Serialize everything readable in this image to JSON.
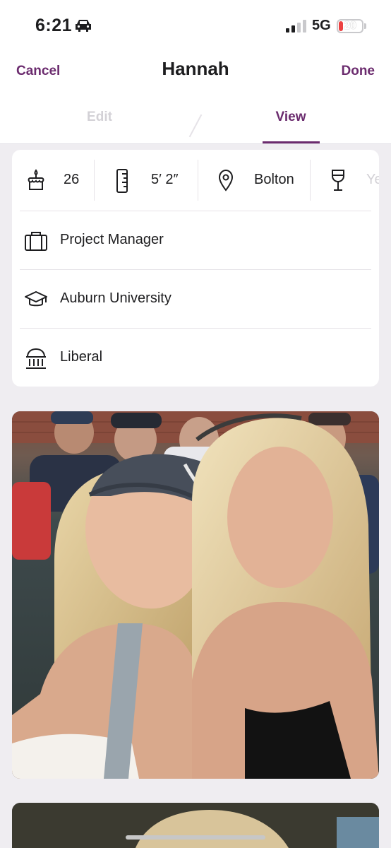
{
  "status_bar": {
    "time": "6:21",
    "network": "5G",
    "battery": "20",
    "battery_level_percent": 20
  },
  "header": {
    "cancel_label": "Cancel",
    "title": "Hannah",
    "done_label": "Done"
  },
  "tabs": [
    {
      "label": "Edit",
      "active": false
    },
    {
      "label": "View",
      "active": true
    }
  ],
  "vitals": [
    {
      "icon": "birthday-cake-icon",
      "value": "26"
    },
    {
      "icon": "ruler-icon",
      "value": "5′ 2″"
    },
    {
      "icon": "location-pin-icon",
      "value": "Bolton"
    },
    {
      "icon": "wine-glass-icon",
      "value": "Ye"
    }
  ],
  "details": [
    {
      "icon": "briefcase-icon",
      "value": "Project Manager"
    },
    {
      "icon": "graduation-cap-icon",
      "value": "Auburn University"
    },
    {
      "icon": "politics-building-icon",
      "value": "Liberal"
    }
  ],
  "colors": {
    "accent": "#6b2b6e",
    "background": "#efedf1",
    "card": "#ffffff",
    "inactive_tab": "#d3d1d6"
  }
}
